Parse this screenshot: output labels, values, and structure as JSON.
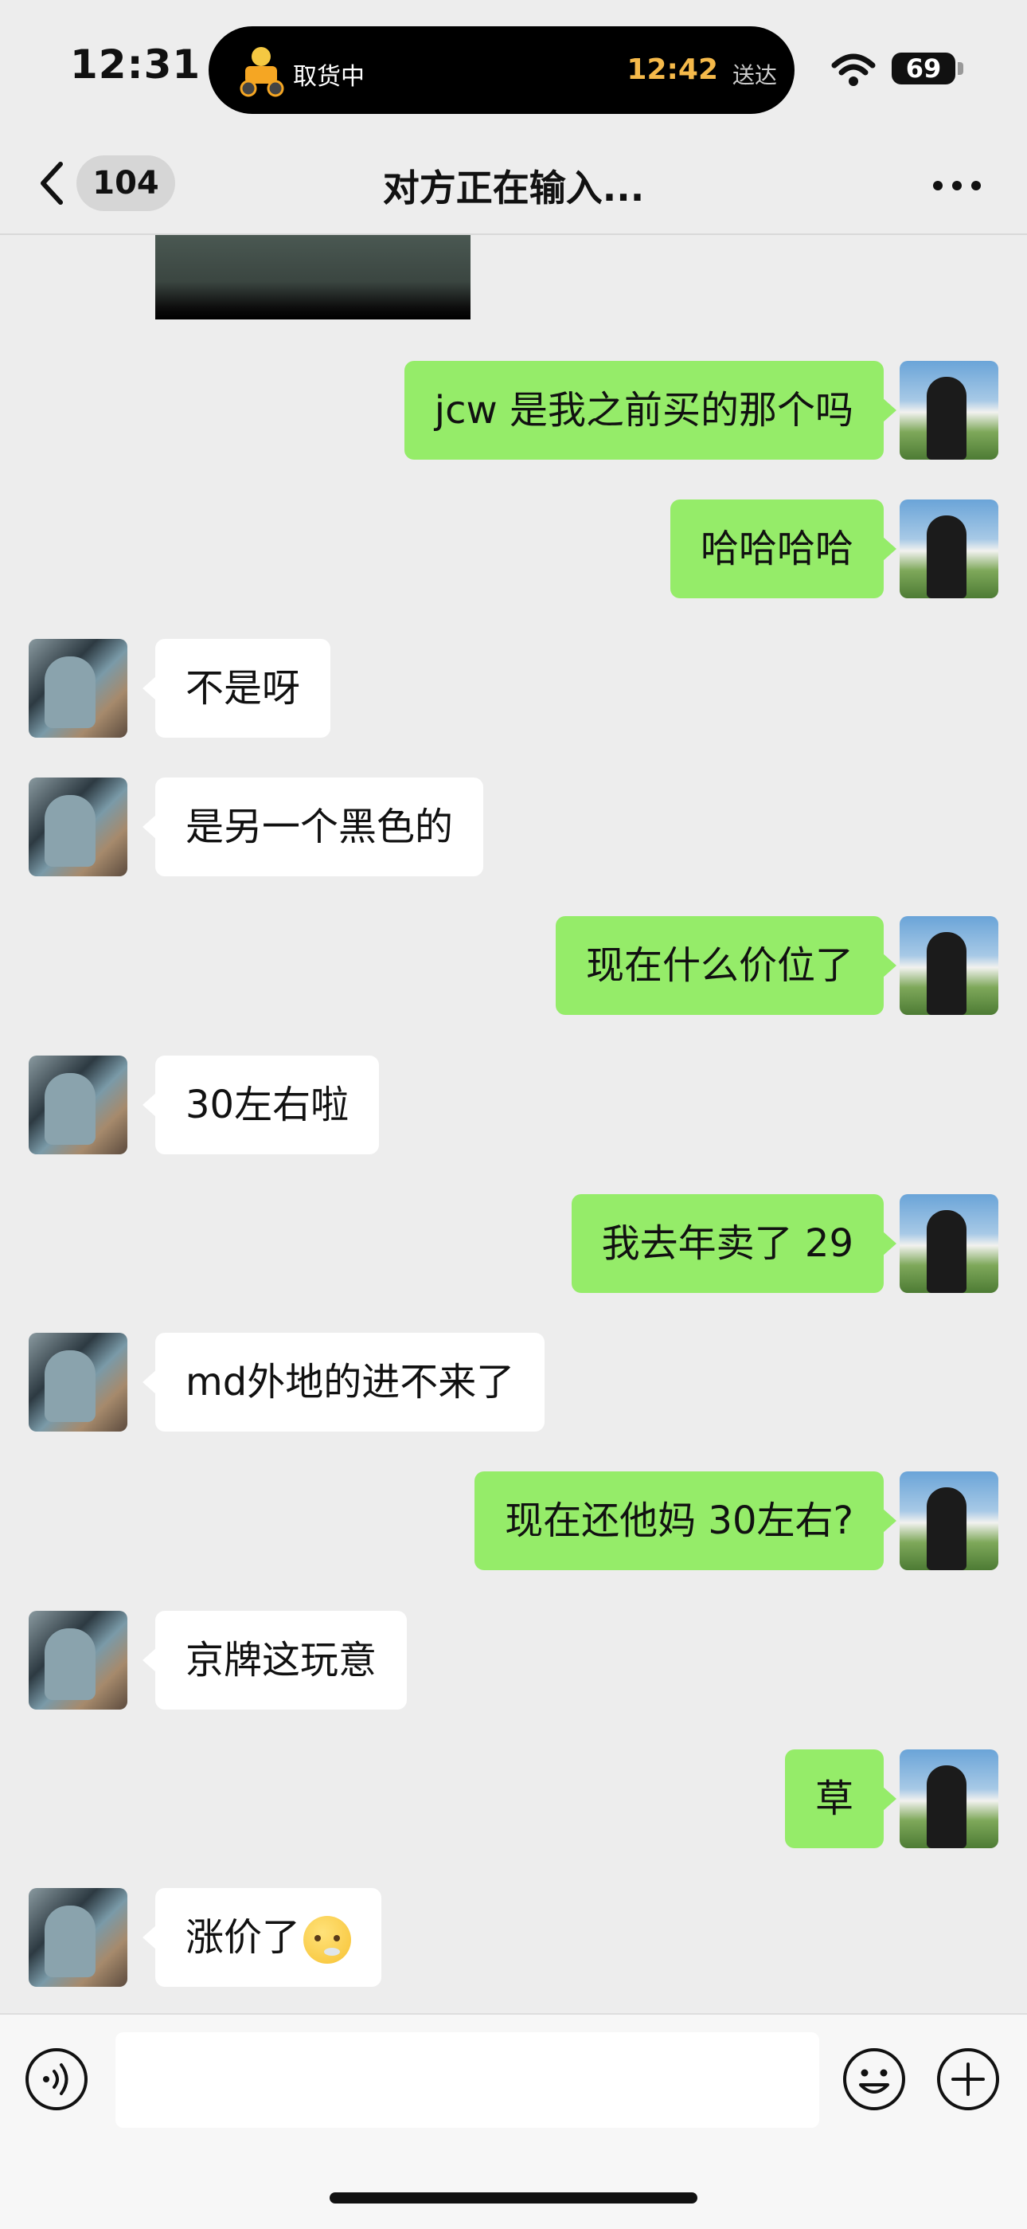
{
  "status_bar": {
    "time": "12:31",
    "live_activity": {
      "label": "取货中",
      "eta": "12:42",
      "eta_suffix": "送达"
    },
    "battery": "69"
  },
  "header": {
    "unread_count": "104",
    "title": "对方正在输入..."
  },
  "messages": [
    {
      "sender": "me",
      "text": "jcw 是我之前买的那个吗"
    },
    {
      "sender": "me",
      "text": "哈哈哈哈"
    },
    {
      "sender": "friend",
      "text": "不是呀"
    },
    {
      "sender": "friend",
      "text": "是另一个黑色的"
    },
    {
      "sender": "me",
      "text": "现在什么价位了"
    },
    {
      "sender": "friend",
      "text": "30左右啦"
    },
    {
      "sender": "me",
      "text": "我去年卖了 29"
    },
    {
      "sender": "friend",
      "text": "md外地的进不来了"
    },
    {
      "sender": "me",
      "text": "现在还他妈 30左右?"
    },
    {
      "sender": "friend",
      "text": "京牌这玩意"
    },
    {
      "sender": "me",
      "text": "草"
    },
    {
      "sender": "friend",
      "text": "涨价了",
      "emoji": "sigh-face"
    }
  ],
  "input_bar": {
    "message_value": ""
  },
  "colors": {
    "my_bubble": "#95ec69",
    "friend_bubble": "#ffffff",
    "background": "#ededed",
    "eta": "#f5b94a"
  }
}
